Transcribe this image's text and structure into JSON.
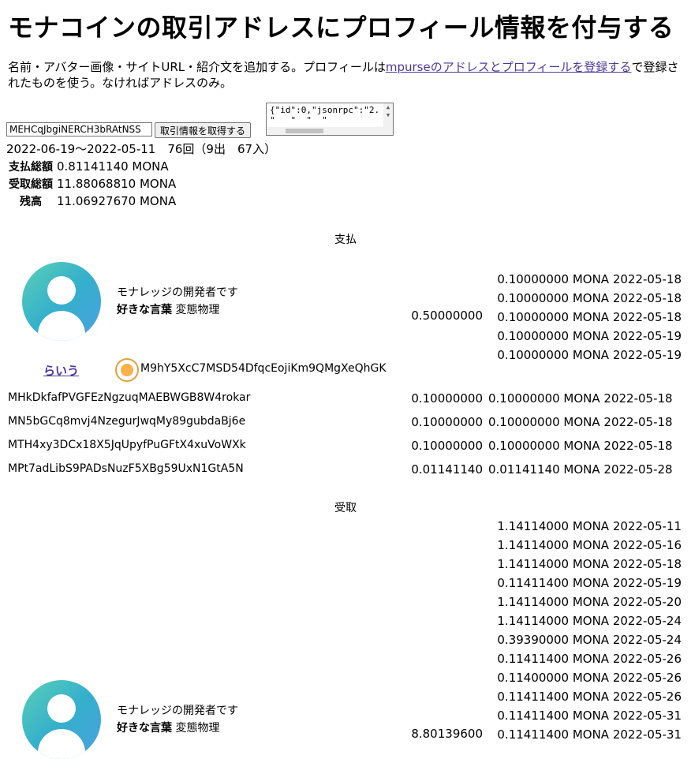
{
  "page": {
    "title": "モナコインの取引アドレスにプロフィール情報を付与する",
    "description_before": "名前・アバター画像・サイトURL・紹介文を追加する。プロフィールは",
    "description_link": "mpurseのアドレスとプロフィールを登録する",
    "description_after": "で登録されたものを使う。なければアドレスのみ。"
  },
  "controls": {
    "address_value": "MEHCqJbgiNERCH3bRAtNSS",
    "fetch_label": "取引情報を取得する",
    "json_line1": "{\"id\":0,\"jsonrpc\":\"2.",
    "json_line2": "\"   \"  \"  \""
  },
  "summary": {
    "range": "2022-06-19〜2022-05-11　76回（9出　67入）",
    "rows": [
      {
        "label": "支払総額",
        "value": "0.81141140 MONA"
      },
      {
        "label": "受取総額",
        "value": "11.88068810 MONA"
      },
      {
        "label": "残高",
        "value": "11.06927670 MONA"
      }
    ]
  },
  "pay": {
    "heading": "支払",
    "profile": {
      "intro": "モナレッジの開発者です",
      "fav_label": "好きな言葉",
      "fav_value": "変態物理",
      "name": "らいう",
      "address": "M9hY5XcC7MSD54DfqcEojiKm9QMgXeQhGK",
      "total": "0.50000000",
      "tx": [
        "0.10000000 MONA 2022-05-18",
        "0.10000000 MONA 2022-05-18",
        "0.10000000 MONA 2022-05-18",
        "0.10000000 MONA 2022-05-19",
        "0.10000000 MONA 2022-05-19"
      ]
    },
    "rows": [
      {
        "address": "MHkDkfafPVGFEzNgzuqMAEBWGB8W4rokar",
        "total": "0.10000000",
        "tx": "0.10000000 MONA 2022-05-18"
      },
      {
        "address": "MN5bGCq8mvj4NzegurJwqMy89gubdaBj6e",
        "total": "0.10000000",
        "tx": "0.10000000 MONA 2022-05-18"
      },
      {
        "address": "MTH4xy3DCx18X5JqUpyfPuGFtX4xuVoWXk",
        "total": "0.10000000",
        "tx": "0.10000000 MONA 2022-05-18"
      },
      {
        "address": "MPt7adLibS9PADsNuzF5XBg59UxN1GtA5N",
        "total": "0.01141140",
        "tx": "0.01141140 MONA 2022-05-28"
      }
    ]
  },
  "receive": {
    "heading": "受取",
    "profile": {
      "intro": "モナレッジの開発者です",
      "fav_label": "好きな言葉",
      "fav_value": "変態物理",
      "total": "8.80139600"
    },
    "tx": [
      "1.14114000 MONA 2022-05-11",
      "1.14114000 MONA 2022-05-16",
      "1.14114000 MONA 2022-05-18",
      "0.11411400 MONA 2022-05-19",
      "1.14114000 MONA 2022-05-20",
      "1.14114000 MONA 2022-05-24",
      "0.39390000 MONA 2022-05-24",
      "0.11411400 MONA 2022-05-26",
      "0.11400000 MONA 2022-05-26",
      "0.11411400 MONA 2022-05-26",
      "0.11411400 MONA 2022-05-31",
      "0.11411400 MONA 2022-05-31"
    ]
  }
}
